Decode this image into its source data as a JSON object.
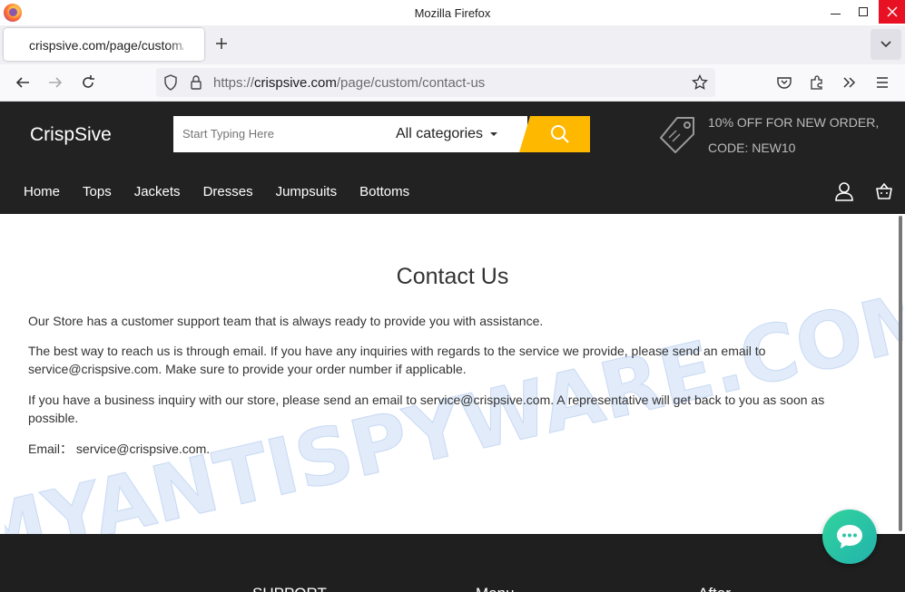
{
  "window": {
    "title": "Mozilla Firefox"
  },
  "browser": {
    "tab_title": "crispsive.com/page/custom/contact-us",
    "url_prefix": "https://",
    "url_domain": "crispsive.com",
    "url_path": "/page/custom/contact-us"
  },
  "site": {
    "brand": "CrispSive",
    "search": {
      "placeholder": "Start Typing Here",
      "category": "All categories"
    },
    "promo": {
      "line1": "10% OFF FOR NEW ORDER,",
      "line2": "CODE: NEW10"
    },
    "nav": [
      "Home",
      "Tops",
      "Jackets",
      "Dresses",
      "Jumpsuits",
      "Bottoms"
    ]
  },
  "content": {
    "title": "Contact Us",
    "p1": "Our Store has a customer support team that is always ready to provide you with assistance.",
    "p2": "The best way to reach us is through email. If you have any inquiries with regards to the service we provide, please send an email to service@crispsive.com. Make sure to provide your order number if applicable.",
    "p3": "If you have a business inquiry with our store, please send an email to service@crispsive.com. A representative will get back to you as soon as possible.",
    "email_label": "Email：",
    "email_value": "service@crispsive.com."
  },
  "watermark": "MYANTISPYWARE.COM",
  "footer": {
    "col1": "SUPPORT",
    "col2": "Menu",
    "col3": "After"
  },
  "colors": {
    "header_bg": "#222222",
    "accent": "#ffb800",
    "chat": "#2bc6a3"
  }
}
